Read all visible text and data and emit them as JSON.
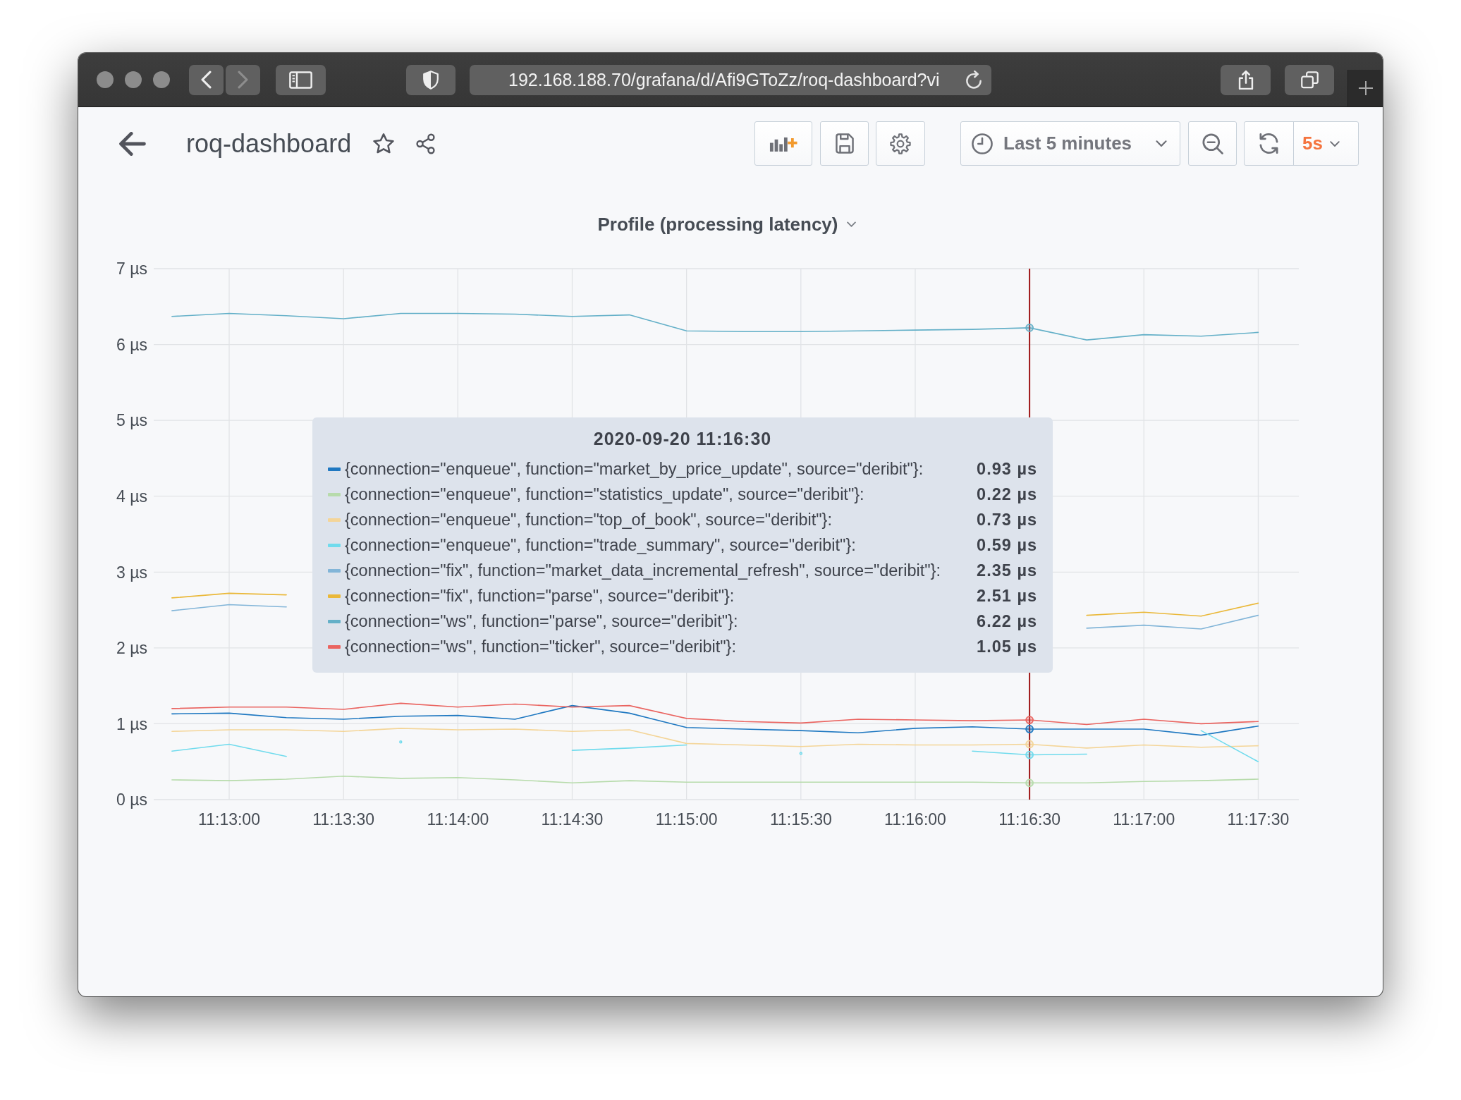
{
  "browser": {
    "nav": [
      {
        "kind": "back",
        "disabled": false
      },
      {
        "kind": "forward",
        "disabled": true
      }
    ],
    "url": "192.168.188.70/grafana/d/Afi9GToZz/roq-dashboard?vi"
  },
  "dashboard": {
    "title": "roq-dashboard",
    "starred": false,
    "time_picker": {
      "label": "Last 5 minutes"
    },
    "refresh": {
      "interval": "5s"
    }
  },
  "panel": {
    "title": "Profile (processing latency)",
    "chart_data": {
      "type": "line",
      "grid": true,
      "categories": [
        null,
        "11:13:00",
        null,
        "11:13:30",
        null,
        "11:14:00",
        null,
        "11:14:30",
        null,
        "11:15:00",
        null,
        "11:15:30",
        null,
        "11:16:00",
        null,
        "11:16:30",
        null,
        "11:17:00",
        null,
        "11:17:30"
      ],
      "ylim": [
        0,
        7
      ],
      "yticks": [
        {
          "value": 0,
          "label": "0 µs"
        },
        {
          "value": 1,
          "label": "1 µs"
        },
        {
          "value": 2,
          "label": "2 µs"
        },
        {
          "value": 3,
          "label": "3 µs"
        },
        {
          "value": 4,
          "label": "4 µs"
        },
        {
          "value": 5,
          "label": "5 µs"
        },
        {
          "value": 6,
          "label": "6 µs"
        },
        {
          "value": 7,
          "label": "7 µs"
        }
      ],
      "series": [
        {
          "color": "#1f78c1",
          "values": [
            1.13,
            1.14,
            1.08,
            1.06,
            1.1,
            1.11,
            1.06,
            1.24,
            1.14,
            0.95,
            0.93,
            0.91,
            0.88,
            0.94,
            0.96,
            0.93,
            0.93,
            0.93,
            0.85,
            0.97
          ]
        },
        {
          "color": "#b7dbab",
          "values": [
            0.26,
            0.25,
            0.27,
            0.31,
            0.28,
            0.29,
            0.26,
            0.22,
            0.25,
            0.23,
            0.23,
            0.23,
            0.23,
            0.23,
            0.23,
            0.22,
            0.22,
            0.24,
            0.25,
            0.27
          ]
        },
        {
          "color": "#f4d598",
          "values": [
            0.9,
            0.92,
            0.92,
            0.9,
            0.94,
            0.92,
            0.93,
            0.9,
            0.92,
            0.74,
            0.72,
            0.7,
            0.73,
            0.72,
            0.72,
            0.73,
            0.68,
            0.72,
            0.69,
            0.71
          ]
        },
        {
          "color": "#70dbed",
          "values": [
            0.64,
            0.73,
            0.57,
            null,
            0.76,
            null,
            null,
            0.65,
            0.68,
            0.72,
            null,
            0.61,
            null,
            null,
            0.64,
            0.59,
            0.6,
            null,
            0.91,
            0.5
          ]
        },
        {
          "color": "#82b5d8",
          "values": [
            2.49,
            2.57,
            2.54,
            null,
            null,
            null,
            null,
            null,
            null,
            null,
            null,
            null,
            null,
            null,
            null,
            null,
            2.26,
            2.3,
            2.25,
            2.43
          ]
        },
        {
          "color": "#eab839",
          "values": [
            2.66,
            2.72,
            2.7,
            null,
            null,
            null,
            null,
            null,
            null,
            null,
            null,
            null,
            null,
            null,
            null,
            null,
            2.43,
            2.47,
            2.42,
            2.59
          ]
        },
        {
          "color": "#64b0c8",
          "values": [
            6.37,
            6.41,
            6.38,
            6.34,
            6.41,
            6.41,
            6.4,
            6.37,
            6.39,
            6.18,
            6.17,
            6.17,
            6.18,
            6.19,
            6.2,
            6.22,
            6.06,
            6.13,
            6.11,
            6.16
          ]
        },
        {
          "color": "#ea6460",
          "values": [
            1.2,
            1.22,
            1.22,
            1.19,
            1.27,
            1.22,
            1.26,
            1.22,
            1.24,
            1.07,
            1.03,
            1.01,
            1.06,
            1.05,
            1.04,
            1.05,
            0.99,
            1.06,
            1.0,
            1.03
          ]
        }
      ],
      "annotations": [
        {
          "x": "11:16:30"
        }
      ]
    },
    "tooltip": {
      "title": "2020-09-20 11:16:30",
      "rows": [
        {
          "label": "{connection=\"enqueue\", function=\"market_by_price_update\", source=\"deribit\"}:",
          "value": "0.93 µs",
          "color": "#1f78c1"
        },
        {
          "label": "{connection=\"enqueue\", function=\"statistics_update\", source=\"deribit\"}:",
          "value": "0.22 µs",
          "color": "#b7dbab"
        },
        {
          "label": "{connection=\"enqueue\", function=\"top_of_book\", source=\"deribit\"}:",
          "value": "0.73 µs",
          "color": "#f4d598"
        },
        {
          "label": "{connection=\"enqueue\", function=\"trade_summary\", source=\"deribit\"}:",
          "value": "0.59 µs",
          "color": "#70dbed"
        },
        {
          "label": "{connection=\"fix\", function=\"market_data_incremental_refresh\", source=\"deribit\"}:",
          "value": "2.35 µs",
          "color": "#82b5d8"
        },
        {
          "label": "{connection=\"fix\", function=\"parse\", source=\"deribit\"}:",
          "value": "2.51 µs",
          "color": "#eab839"
        },
        {
          "label": "{connection=\"ws\", function=\"parse\", source=\"deribit\"}:",
          "value": "6.22 µs",
          "color": "#64b0c8"
        },
        {
          "label": "{connection=\"ws\", function=\"ticker\", source=\"deribit\"}:",
          "value": "1.05 µs",
          "color": "#ea6460"
        }
      ]
    }
  }
}
